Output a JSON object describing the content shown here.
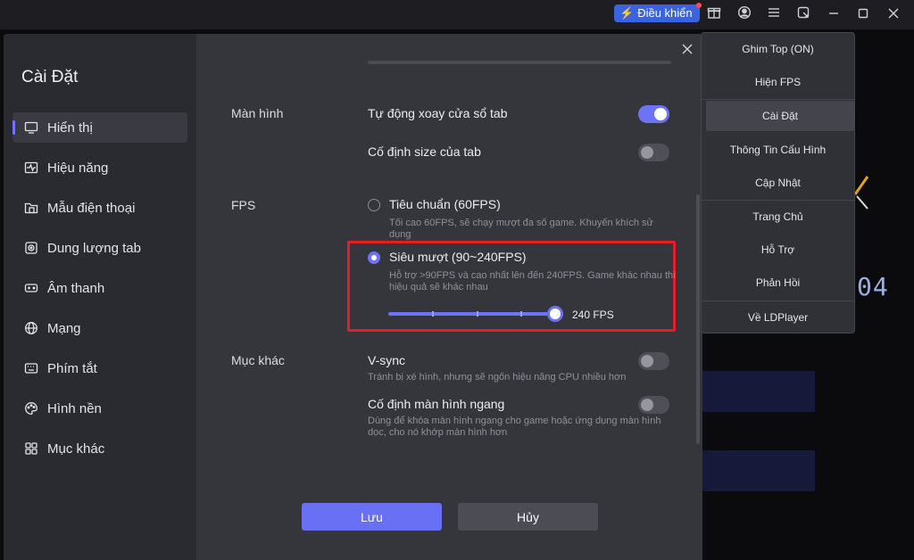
{
  "topbar": {
    "control_label": "Điều khiển",
    "icons": [
      "lightning-icon",
      "gift-icon",
      "user-icon",
      "menu-icon",
      "resize-icon",
      "minimize-icon",
      "maximize-icon",
      "close-icon"
    ]
  },
  "background": {
    "number": "04"
  },
  "settings": {
    "title": "Cài Đặt",
    "nav": [
      {
        "label": "Hiển thị",
        "icon": "monitor-icon",
        "active": true
      },
      {
        "label": "Hiệu năng",
        "icon": "pulse-icon"
      },
      {
        "label": "Mẫu điện thoại",
        "icon": "folder-phone-icon"
      },
      {
        "label": "Dung lượng tab",
        "icon": "storage-icon"
      },
      {
        "label": "Âm thanh",
        "icon": "gamepad-icon"
      },
      {
        "label": "Mạng",
        "icon": "globe-icon"
      },
      {
        "label": "Phím tắt",
        "icon": "keyboard-icon"
      },
      {
        "label": "Hình nền",
        "icon": "palette-icon"
      },
      {
        "label": "Mục khác",
        "icon": "grid-icon"
      }
    ],
    "screen": {
      "label": "Màn hình",
      "auto_rotate": {
        "label": "Tự động xoay cửa sổ tab",
        "on": true
      },
      "fixed_size": {
        "label": "Cố định size của tab",
        "on": false
      }
    },
    "fps": {
      "label": "FPS",
      "standard": {
        "label": "Tiêu chuẩn (60FPS)",
        "desc": "Tối cao 60FPS, sẽ chạy mượt đa số game. Khuyến khích sử dụng",
        "selected": false
      },
      "smooth": {
        "label": "Siêu mượt (90~240FPS)",
        "desc": "Hỗ trợ >90FPS và cao nhất lên đến 240FPS. Game khác nhau thì hiệu quả sẽ khác nhau",
        "selected": true
      },
      "slider": {
        "min": 90,
        "max": 240,
        "value": 240,
        "value_label": "240 FPS"
      }
    },
    "other": {
      "label": "Mục khác",
      "vsync": {
        "label": "V-sync",
        "desc": "Tránh bị xé hình, nhưng sẽ ngốn hiệu năng CPU nhiều hơn",
        "on": false
      },
      "landscape": {
        "label": "Cố định màn hình ngang",
        "desc": "Dùng để khóa màn hình ngang cho game hoặc ứng dụng màn hình dọc, cho nó khớp màn hình hơn",
        "on": false
      }
    },
    "buttons": {
      "save": "Lưu",
      "cancel": "Hủy"
    }
  },
  "menu": {
    "items": [
      "Ghim Top (ON)",
      "Hiện FPS",
      "Cài Đặt",
      "Thông Tin Cấu Hình",
      "Cập Nhật",
      "Trang Chủ",
      "Hỗ Trợ",
      "Phản Hồi",
      "Về LDPlayer"
    ],
    "active_index": 2
  },
  "colors": {
    "accent": "#6c73f5",
    "highlight": "#e31e24",
    "control_button": "#3a63e0"
  }
}
